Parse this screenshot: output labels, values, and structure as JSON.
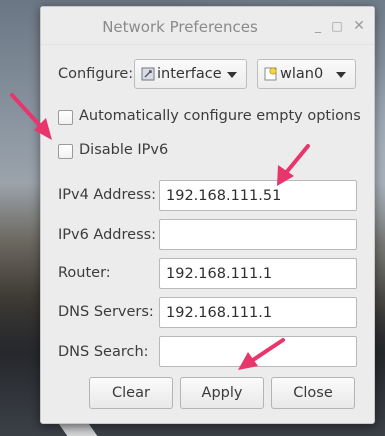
{
  "window": {
    "title": "Network Preferences",
    "controls": {
      "minimize": "_",
      "maximize": "□",
      "close": "✕"
    }
  },
  "configure": {
    "label": "Configure:",
    "type_select": {
      "value": "interface",
      "icon": "network-interface-icon"
    },
    "device_select": {
      "value": "wlan0",
      "icon": "wireless-device-icon"
    }
  },
  "options": {
    "auto_configure": {
      "label": "Automatically configure empty options",
      "checked": false
    },
    "disable_ipv6": {
      "label": "Disable IPv6",
      "checked": false
    }
  },
  "fields": {
    "ipv4": {
      "label": "IPv4 Address:",
      "value": "192.168.111.51"
    },
    "ipv6": {
      "label": "IPv6 Address:",
      "value": ""
    },
    "router": {
      "label": "Router:",
      "value": "192.168.111.1"
    },
    "dns_servers": {
      "label": "DNS Servers:",
      "value": "192.168.111.1"
    },
    "dns_search": {
      "label": "DNS Search:",
      "value": ""
    }
  },
  "buttons": {
    "clear": "Clear",
    "apply": "Apply",
    "close": "Close"
  },
  "colors": {
    "annotation_arrow": "#e8356b",
    "window_bg": "#ececec"
  }
}
